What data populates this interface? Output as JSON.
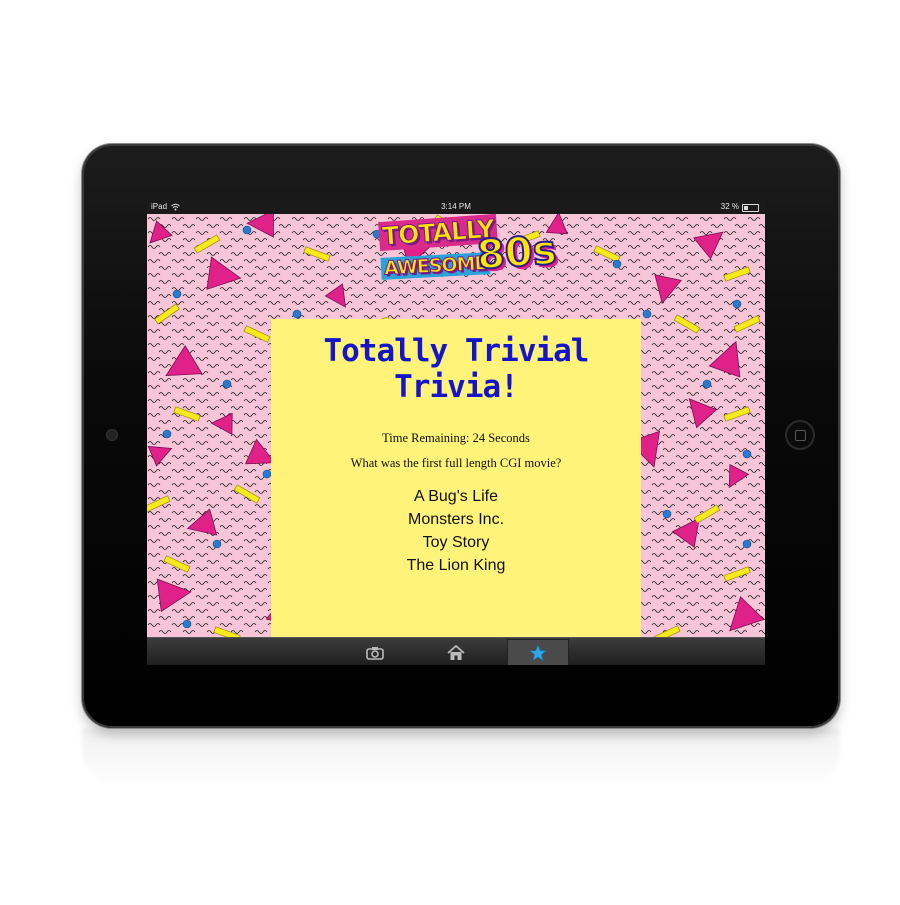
{
  "statusbar": {
    "carrier": "iPad",
    "time": "3:14 PM",
    "battery": "32 %"
  },
  "logo": {
    "line1": "TOTALLY",
    "line2": "AWESOME",
    "number": "80s"
  },
  "trivia": {
    "title": "Totally Trivial Trivia!",
    "timer": "Time Remaining: 24 Seconds",
    "question": "What was the first full length CGI movie?",
    "answers": [
      "A Bug's Life",
      "Monsters Inc.",
      "Toy Story",
      "The Lion King"
    ]
  },
  "tabbar": {
    "tabs": [
      {
        "icon": "camera-icon",
        "active": false
      },
      {
        "icon": "home-icon",
        "active": false
      },
      {
        "icon": "star-icon",
        "active": true
      }
    ]
  },
  "colors": {
    "background_pink": "#f6c6d8",
    "panel_yellow": "#fff37a",
    "title_blue": "#1414c8",
    "triangle_magenta": "#e0218a",
    "bar_yellow": "#f7ea1c",
    "dot_blue": "#2a7ad0"
  }
}
